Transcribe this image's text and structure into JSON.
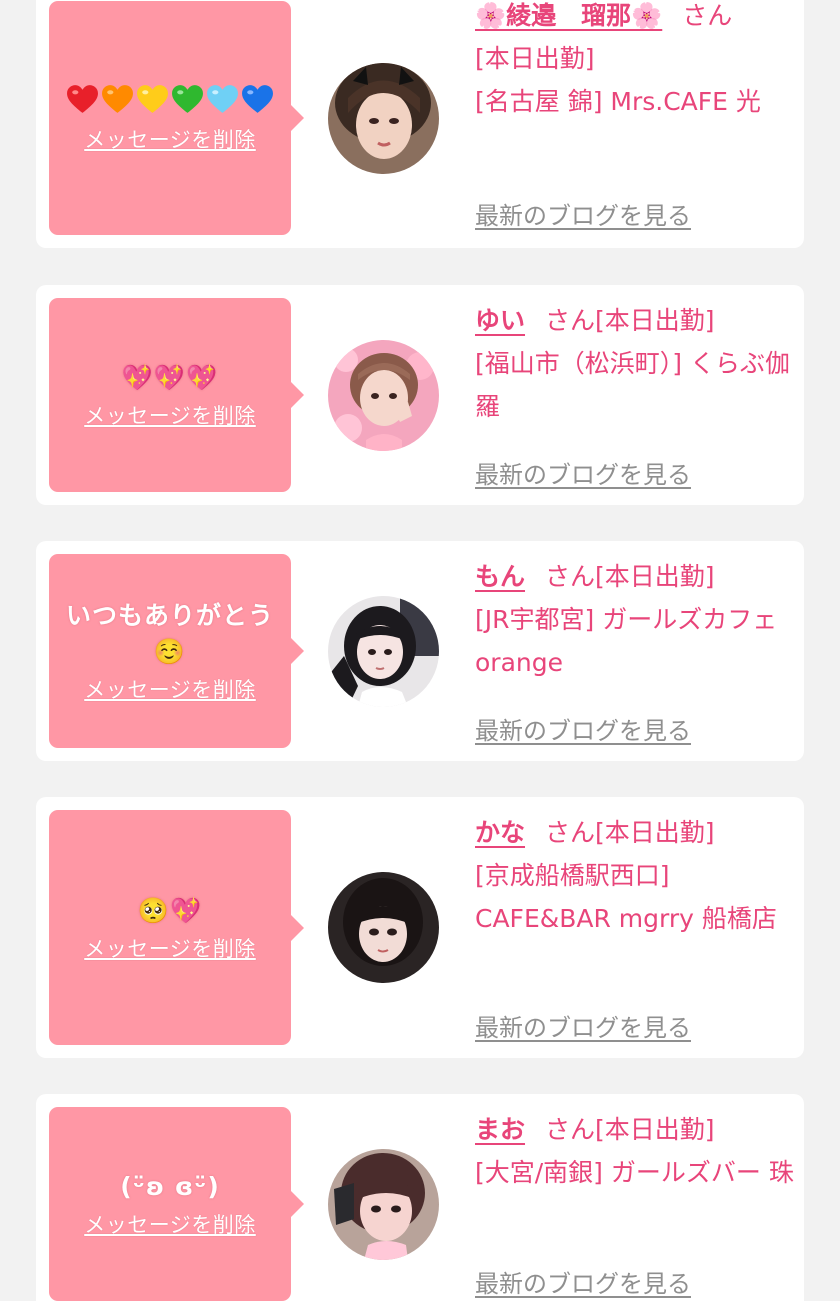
{
  "messages": [
    {
      "message_text": "",
      "message_emoji": [
        "red-heart",
        "orange-heart",
        "yellow-heart",
        "green-heart",
        "light-blue-heart",
        "blue-heart"
      ],
      "delete_label": "メッセージを削除",
      "name": "🌸綾邉　瑠那🌸",
      "honorific": "さん",
      "status": "[本日出勤]",
      "shop": "[名古屋 錦] Mrs.CAFE 光",
      "blog_label": "最新のブログを見る"
    },
    {
      "message_text": "💖💖💖",
      "delete_label": "メッセージを削除",
      "name": "ゆい",
      "honorific": "さん",
      "status": "[本日出勤]",
      "shop": "[福山市（松浜町）] くらぶ伽羅",
      "blog_label": "最新のブログを見る"
    },
    {
      "message_text": "いつもありがとう☺️",
      "delete_label": "メッセージを削除",
      "name": "もん",
      "honorific": "さん",
      "status": "[本日出勤]",
      "shop": "[JR宇都宮] ガールズカフェ orange",
      "blog_label": "最新のブログを見る"
    },
    {
      "message_text": "🥺💖",
      "delete_label": "メッセージを削除",
      "name": "かな",
      "honorific": "さん",
      "status": "[本日出勤]",
      "shop": "[京成船橋駅西口] CAFE&BAR mgrry 船橋店",
      "blog_label": "最新のブログを見る"
    },
    {
      "message_text": "(ᵕ̈ʚ ɞᵕ̈)",
      "delete_label": "メッセージを削除",
      "name": "まお",
      "honorific": "さん",
      "status": "[本日出勤]",
      "shop": "[大宮/南銀] ガールズバー 珠",
      "blog_label": "最新のブログを見る"
    }
  ],
  "colors": {
    "bubble": "#ff97a5",
    "accent": "#e8457a",
    "link_gray": "#8f8f8f",
    "background": "#f2f2f2"
  }
}
